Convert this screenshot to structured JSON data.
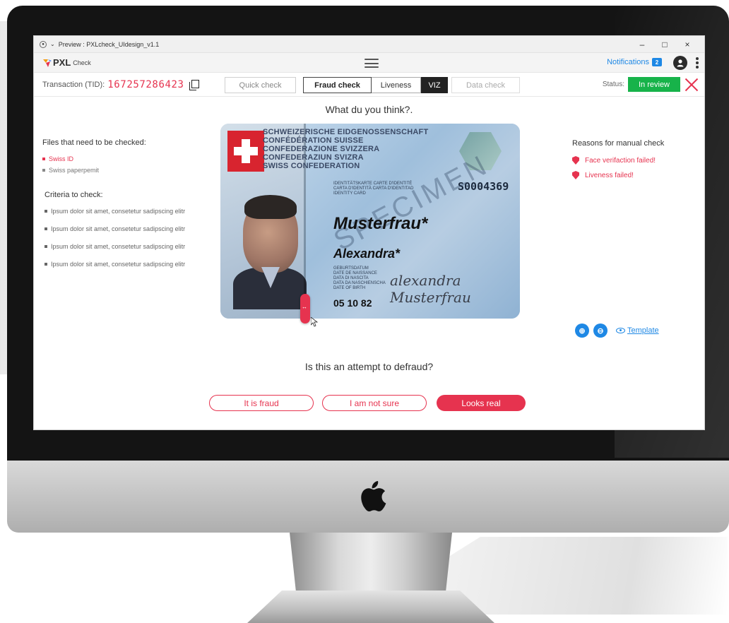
{
  "window": {
    "title": "Preview : PXLcheck_UIdesign_v1.1",
    "minimize": "–",
    "maximize": "□",
    "close": "×"
  },
  "app": {
    "brand": "PXL",
    "brand_sub": "Check",
    "notifications_label": "Notifications",
    "notifications_count": "2"
  },
  "transaction": {
    "label": "Transaction (TID):",
    "id": "167257286423"
  },
  "tabs": {
    "quick": "Quick check",
    "fraud": "Fraud check",
    "liveness": "Liveness",
    "viz": "VIZ",
    "data": "Data check"
  },
  "status": {
    "label": "Status:",
    "value": "In review"
  },
  "main": {
    "question_top": "What du you think?.",
    "question_bottom": "Is this an attempt to defraud?"
  },
  "files": {
    "title": "Files that need to be checked:",
    "items": [
      "Swiss ID",
      "Swiss paperpemit"
    ]
  },
  "criteria": {
    "title": "Criteria to check:",
    "items": [
      "Ipsum dolor sit amet, consetetur sadipscing elitr",
      "Ipsum dolor sit amet, consetetur sadipscing elitr",
      "Ipsum dolor sit amet, consetetur sadipscing elitr",
      "Ipsum dolor sit amet, consetetur sadipscing elitr"
    ]
  },
  "reasons": {
    "title": "Reasons for manual check",
    "items": [
      "Face verifaction failed!",
      "Liveness failed!"
    ]
  },
  "tools": {
    "template_label": "Template"
  },
  "id_card": {
    "header": [
      "SCHWEIZERISCHE EIDGENOSSENSCHAFT",
      "CONFÉDÉRATION SUISSE",
      "CONFEDERAZIONE SVIZZERA",
      "CONFEDERAZIUN SVIZRA",
      "SWISS CONFEDERATION"
    ],
    "doc_type": [
      "IDENTITÄTSKARTE CARTE D'IDENTITÉ",
      "CARTA D'IDENTITÀ CARTA D'IDENTITAD",
      "IDENTITY CARD"
    ],
    "doc_number": "S0004369",
    "surname": "Musterfrau*",
    "given_name": "Alexandra*",
    "dob_labels": [
      "GEBURTSDATUM",
      "DATE DE NAISSANCE",
      "DATA DI NASCITA",
      "DATA DA NASCHIENSCHA",
      "DATE OF BIRTH"
    ],
    "dob": "05 10 82",
    "signature": "alexandra Musterfrau",
    "watermark": "SPECIMEN"
  },
  "actions": {
    "fraud": "It is fraud",
    "unsure": "I am not sure",
    "real": "Looks real"
  }
}
